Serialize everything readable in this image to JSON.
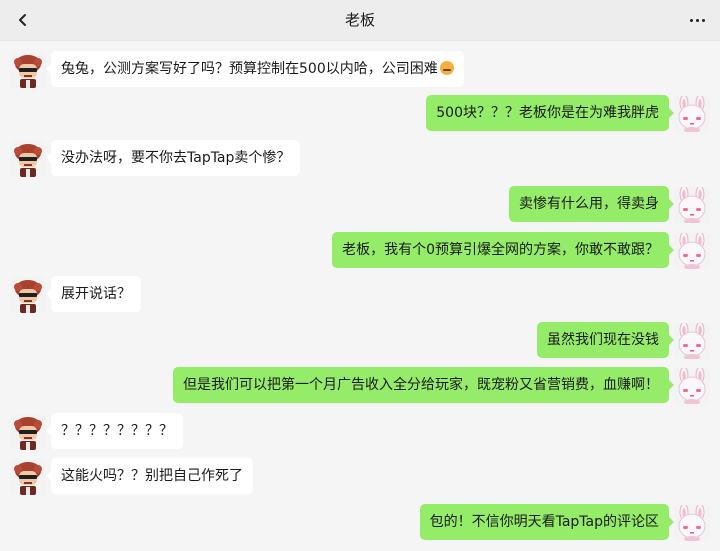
{
  "header": {
    "title": "老板",
    "back_icon": "chevron-left-icon",
    "more_icon": "more-icon"
  },
  "messages": [
    {
      "side": "left",
      "text": "兔兔，公测方案写好了吗？预算控制在500以内哈，公司困难",
      "emoji": "sad-face-emoji"
    },
    {
      "side": "right",
      "text": "500块？？？老板你是在为难我胖虎"
    },
    {
      "side": "left",
      "text": "没办法呀，要不你去TapTap卖个惨？"
    },
    {
      "side": "right",
      "text": "卖惨有什么用，得卖身"
    },
    {
      "side": "right",
      "text": "老板，我有个0预算引爆全网的方案，你敢不敢跟？"
    },
    {
      "side": "left",
      "text": "展开说话？"
    },
    {
      "side": "right",
      "text": "虽然我们现在没钱"
    },
    {
      "side": "right",
      "text": "但是我们可以把第一个月广告收入全分给玩家，既宠粉又省营销费，血赚啊！"
    },
    {
      "side": "left",
      "text": "？？？？？？？？"
    },
    {
      "side": "left",
      "text": "这能火吗？？别把自己作死了"
    },
    {
      "side": "right",
      "text": "包的！不信你明天看TapTap的评论区"
    }
  ],
  "colors": {
    "outgoing_bubble": "#95ec69",
    "incoming_bubble": "#ffffff",
    "background": "#f5f5f5"
  }
}
